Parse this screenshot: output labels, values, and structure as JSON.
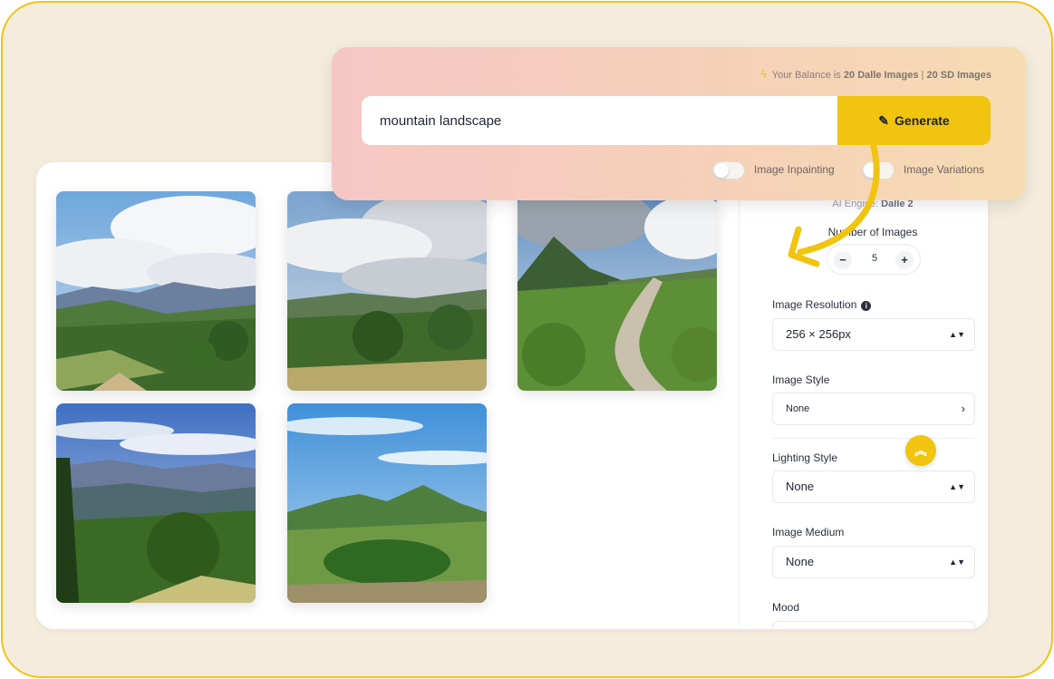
{
  "balance": {
    "prefix": "Your Balance is",
    "dalle": "20 Dalle Images",
    "separator": "|",
    "sd": "20 SD Images"
  },
  "prompt": {
    "value": "mountain landscape",
    "generate_label": "Generate"
  },
  "toggles": {
    "inpainting_label": "Image Inpainting",
    "variations_label": "Image Variations"
  },
  "settings": {
    "engine_prefix": "AI Engine:",
    "engine_value": "Dalle 2",
    "number_of_images_label": "Number of Images",
    "number_of_images_value": "5",
    "resolution_label": "Image Resolution",
    "resolution_value": "256 × 256px",
    "style_label": "Image Style",
    "style_value": "None",
    "lighting_label": "Lighting Style",
    "lighting_value": "None",
    "medium_label": "Image Medium",
    "medium_value": "None",
    "mood_label": "Mood"
  },
  "gallery": {
    "images": [
      {
        "name": "generated-image-1",
        "alt": "mountain landscape"
      },
      {
        "name": "generated-image-2",
        "alt": "mountain landscape"
      },
      {
        "name": "generated-image-3",
        "alt": "mountain landscape"
      },
      {
        "name": "generated-image-4",
        "alt": "mountain landscape"
      },
      {
        "name": "generated-image-5",
        "alt": "mountain landscape"
      }
    ]
  },
  "colors": {
    "accent": "#f1c40f",
    "frame_bg": "#f4ecdc",
    "panel_gradient_start": "#f5c7c4",
    "panel_gradient_end": "#f6dcb2"
  },
  "icons": {
    "balance": "lightning-bolt-icon",
    "generate": "magic-wand-icon",
    "info": "info-icon",
    "select_caret": "up-down-caret-icon",
    "chevron": "chevron-right-icon",
    "scroll_top": "double-chevron-up-icon"
  }
}
